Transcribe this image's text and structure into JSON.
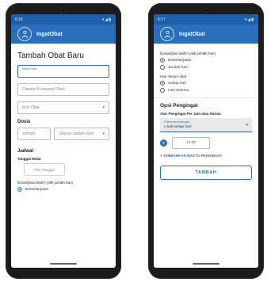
{
  "app": {
    "title": "IngatObat"
  },
  "left": {
    "status": {
      "time": "6:16",
      "icons": "▾◢▮"
    },
    "page_title": "Tambah Obat Baru",
    "fields": {
      "name_label": "Nama Obat",
      "notes_placeholder": "Catatan Konsumsi Obat",
      "icon_placeholder": "Ikon Obat"
    },
    "dose": {
      "section": "Dosis",
      "amount_placeholder": "Jumlah",
      "unit_placeholder": "Ukuran satuan obat"
    },
    "schedule": {
      "section": "Jadwal",
      "start_label": "Tanggal Mulai",
      "pick_date": "Pilih Tanggal",
      "duration_label": "Durasi(bisa lebih? pilih jumlah hari)",
      "option_continuous": "Berkelanjutan"
    }
  },
  "right": {
    "status": {
      "time": "6:17",
      "icons": "▾◢▮"
    },
    "duration_label": "Durasi(bisa lebih? pilih jumlah hari)",
    "duration_options": [
      "Berkelanjutan",
      "Jumlah hari"
    ],
    "days_label": "Hari minum obat",
    "days_options": [
      "Setiap hari",
      "Hari tertentu"
    ],
    "reminder": {
      "section": "Opsi Pengingat",
      "interval_label": "Atur Pengingat Per Jam atau Harian",
      "dropdown_float": "Frekuensi pengingat",
      "dropdown_value": "x kali setiap hari",
      "time_value": "12:00",
      "add_time": "+ TAMBAHKAN WAKTU PENGINGAT",
      "submit": "TAMBAH"
    }
  },
  "colors": {
    "primary": "#2a6fbd",
    "status_bar": "#1d5fa8"
  }
}
